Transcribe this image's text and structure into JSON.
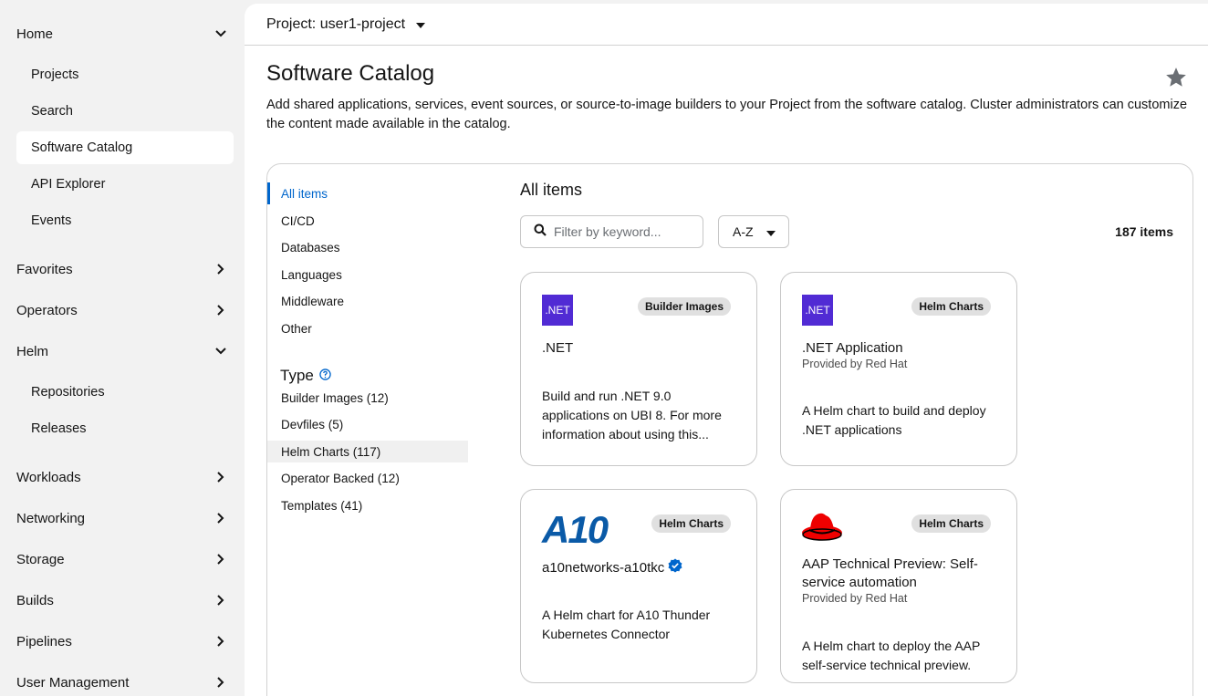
{
  "sidebar": {
    "home": "Home",
    "home_items": [
      "Projects",
      "Search",
      "Software Catalog",
      "API Explorer",
      "Events"
    ],
    "favorites": "Favorites",
    "operators": "Operators",
    "helm": "Helm",
    "helm_items": [
      "Repositories",
      "Releases"
    ],
    "workloads": "Workloads",
    "networking": "Networking",
    "storage": "Storage",
    "builds": "Builds",
    "pipelines": "Pipelines",
    "user_management": "User Management"
  },
  "project": {
    "label": "Project: user1-project"
  },
  "page": {
    "title": "Software Catalog",
    "description": "Add shared applications, services, event sources, or source-to-image builders to your Project from the software catalog. Cluster administrators can customize the content made available in the catalog."
  },
  "categories": [
    "All items",
    "CI/CD",
    "Databases",
    "Languages",
    "Middleware",
    "Other"
  ],
  "type": {
    "heading": "Type",
    "items": [
      "Builder Images (12)",
      "Devfiles (5)",
      "Helm Charts (117)",
      "Operator Backed (12)",
      "Templates (41)"
    ]
  },
  "items": {
    "title": "All items",
    "filter_placeholder": "Filter by keyword...",
    "sort": "A-Z",
    "count": "187 items"
  },
  "cards": [
    {
      "badge": "Builder Images",
      "icon_text": ".NET",
      "title": ".NET",
      "description": "Build and run .NET 9.0 applications on UBI 8. For more information about using this..."
    },
    {
      "badge": "Helm Charts",
      "icon_text": ".NET",
      "title": ".NET Application",
      "provider": "Provided by Red Hat",
      "description": "A Helm chart to build and deploy .NET applications"
    },
    {
      "badge": "Helm Charts",
      "logo_text": "A10",
      "title": "a10networks-a10tkc",
      "description": "A Helm chart for A10 Thunder Kubernetes Connector"
    },
    {
      "badge": "Helm Charts",
      "title": "AAP Technical Preview: Self-service automation",
      "provider": "Provided by Red Hat",
      "description": "A Helm chart to deploy the AAP self-service technical preview."
    }
  ],
  "colors": {
    "accent": "#0066cc",
    "dotnet": "#512bd4",
    "a10": "#0a5aa7",
    "redhat": "#ee0000",
    "verified": "#0066cc"
  }
}
